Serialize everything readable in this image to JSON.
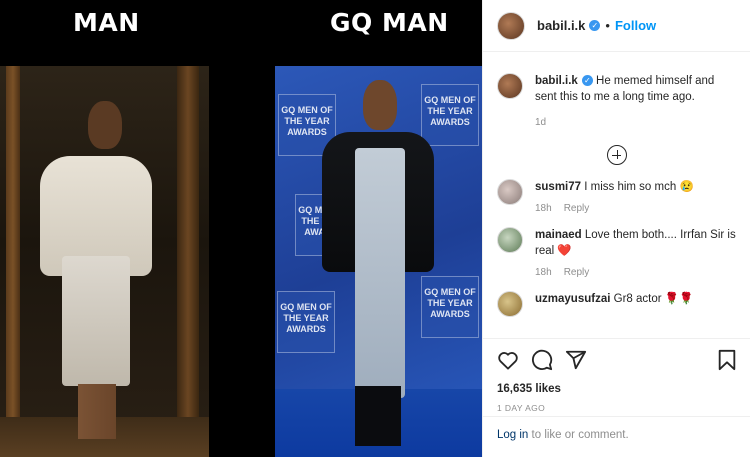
{
  "image": {
    "caption_left": "MAN",
    "caption_right": "GQ MAN",
    "wall_logo_text": "GQ MEN OF THE YEAR AWARDS"
  },
  "header": {
    "username": "babil.i.k",
    "separator": "•",
    "follow_label": "Follow"
  },
  "caption": {
    "username": "babil.i.k",
    "text": "He memed himself and sent this to me a long time ago.",
    "age": "1d"
  },
  "comments": [
    {
      "username": "susmi77",
      "text": "I miss him so mch 😢",
      "age": "18h",
      "reply": "Reply"
    },
    {
      "username": "mainaed",
      "text": "Love them both.... Irrfan Sir is real ❤️",
      "age": "18h",
      "reply": "Reply"
    },
    {
      "username": "uzmayusufzai",
      "text": "Gr8 actor 🌹🌹"
    }
  ],
  "post": {
    "likes": "16,635 likes",
    "date": "1 DAY AGO"
  },
  "login": {
    "link": "Log in",
    "rest": " to like or comment."
  },
  "colors": {
    "accent": "#0095f6",
    "verified": "#3897f0"
  },
  "icons": [
    "heart-icon",
    "comment-icon",
    "share-icon",
    "bookmark-icon",
    "plus-circle-icon",
    "verified-badge-icon"
  ]
}
